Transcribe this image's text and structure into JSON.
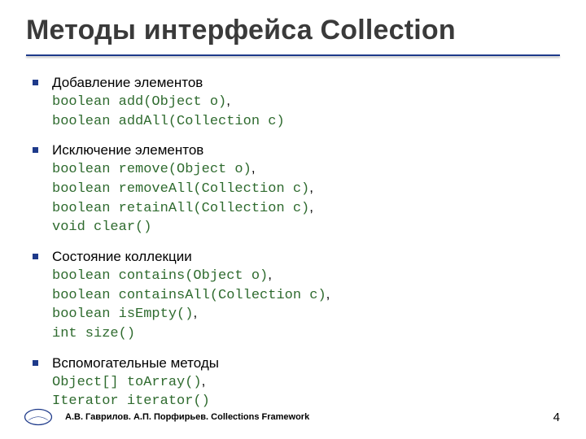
{
  "title": "Методы интерфейса Collection",
  "items": [
    {
      "heading": "Добавление элементов",
      "codes": [
        "boolean add(Object o)",
        "boolean addAll(Collection c)"
      ]
    },
    {
      "heading": "Исключение элементов",
      "codes": [
        "boolean remove(Object o)",
        "boolean removeAll(Collection c)",
        "boolean retainAll(Collection c)",
        "void clear()"
      ]
    },
    {
      "heading": "Состояние коллекции",
      "codes": [
        "boolean contains(Object o)",
        "boolean containsAll(Collection c)",
        "boolean isEmpty()",
        "int size()"
      ]
    },
    {
      "heading": "Вспомогательные методы",
      "codes": [
        "Object[] toArray()",
        "Iterator iterator()"
      ]
    }
  ],
  "footer": "А.В. Гаврилов. А.П. Порфирьев. Collections Framework",
  "page": "4"
}
